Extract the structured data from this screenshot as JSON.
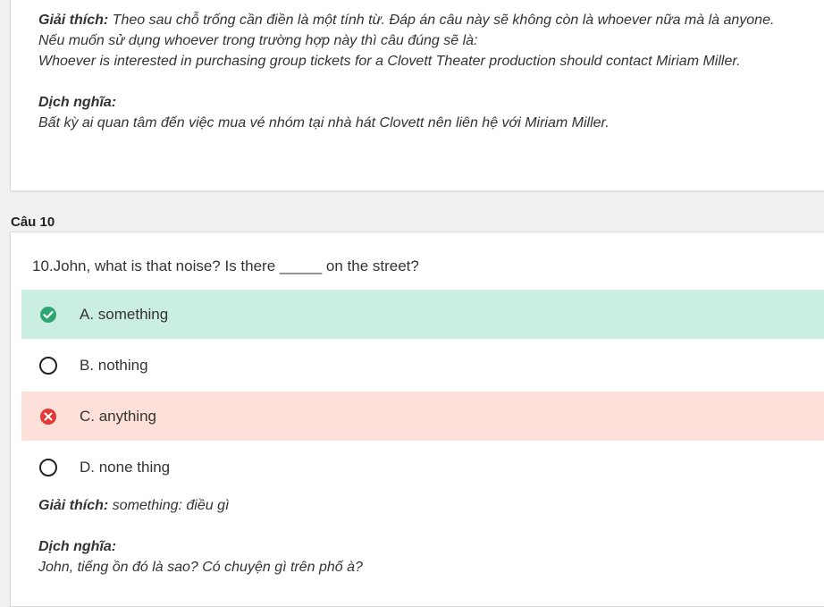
{
  "prev": {
    "explain_label": "Giải thích:",
    "explain_text": " Theo sau chỗ trống cần điền là một tính từ. Đáp án câu này sẽ không còn là whoever nữa mà là anyone.",
    "line2": "Nếu muốn sử dụng whoever trong trường hợp này thì câu đúng sẽ là:",
    "line3": "Whoever is interested in purchasing group tickets for a Clovett Theater production should contact Miriam Miller.",
    "translate_label": "Dịch nghĩa:",
    "translate_text": "Bất kỳ ai quan tâm đến việc mua vé nhóm tại nhà hát Clovett nên liên hệ với Miriam Miller."
  },
  "question": {
    "label": "Câu 10",
    "text": "10.John, what is that noise? Is there _____ on the street?",
    "options": [
      {
        "label": "A. something",
        "state": "correct",
        "icon": "check-circle-icon"
      },
      {
        "label": "B. nothing",
        "state": "none",
        "icon": "radio-icon"
      },
      {
        "label": "C. anything",
        "state": "wrong",
        "icon": "x-circle-icon"
      },
      {
        "label": "D. none thing",
        "state": "none",
        "icon": "radio-icon"
      }
    ],
    "explain_label": "Giải thích:",
    "explain_text": " something: điều gì",
    "translate_label": "Dịch nghĩa:",
    "translate_text": "John, tiếng ồn đó là sao? Có chuyện gì trên phố à?"
  },
  "colors": {
    "correct_bg": "#cbeee2",
    "wrong_bg": "#fde0d9",
    "correct_icon": "#2fa672",
    "wrong_icon": "#e53935"
  }
}
